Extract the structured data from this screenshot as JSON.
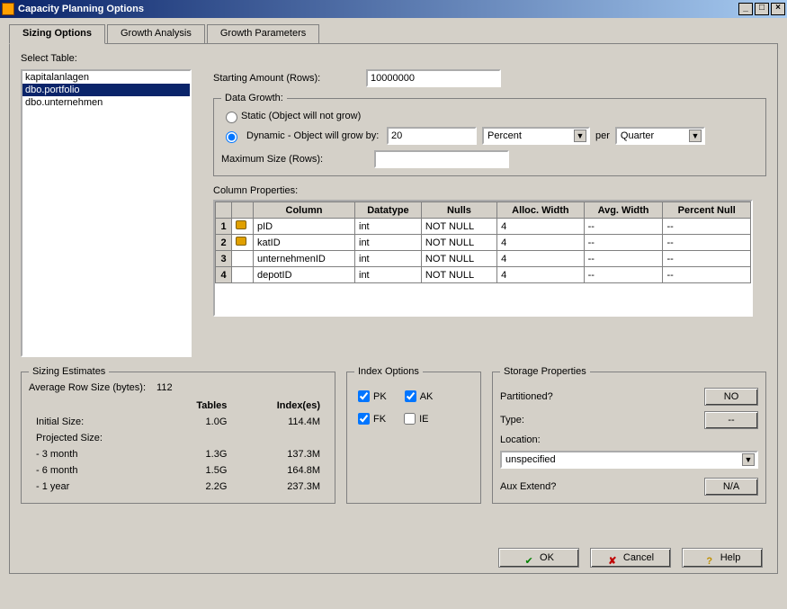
{
  "window": {
    "title": "Capacity Planning Options"
  },
  "tabs": [
    "Sizing Options",
    "Growth Analysis",
    "Growth Parameters"
  ],
  "active_tab": 0,
  "labels": {
    "select_table": "Select Table:",
    "starting_amount": "Starting Amount (Rows):",
    "data_growth": "Data Growth:",
    "static": "Static (Object will not grow)",
    "dynamic": "Dynamic - Object will grow by:",
    "per": "per",
    "max_size": "Maximum Size (Rows):",
    "column_props": "Column Properties:",
    "sizing_estimates": "Sizing Estimates",
    "avg_row_size": "Average Row Size (bytes):",
    "tables": "Tables",
    "indexes": "Index(es)",
    "initial_size": "Initial Size:",
    "projected_size": "Projected Size:",
    "m3": "- 3 month",
    "m6": "- 6 month",
    "y1": "- 1 year",
    "index_options": "Index Options",
    "pk": "PK",
    "ak": "AK",
    "fk": "FK",
    "ie": "IE",
    "storage_props": "Storage Properties",
    "partitioned": "Partitioned?",
    "type": "Type:",
    "location": "Location:",
    "aux_extend": "Aux Extend?"
  },
  "tables_list": [
    "kapitalanlagen",
    "dbo.portfolio",
    "dbo.unternehmen"
  ],
  "tables_selected_index": 1,
  "starting_rows": "10000000",
  "growth": {
    "mode": "dynamic",
    "amount": "20",
    "unit": "Percent",
    "period": "Quarter",
    "max_rows": ""
  },
  "columns_header": [
    "Column",
    "Datatype",
    "Nulls",
    "Alloc. Width",
    "Avg. Width",
    "Percent Null"
  ],
  "columns": [
    {
      "icon": true,
      "name": "pID",
      "datatype": "int",
      "nulls": "NOT NULL",
      "alloc": "4",
      "avg": "--",
      "pct": "--"
    },
    {
      "icon": true,
      "name": "katID",
      "datatype": "int",
      "nulls": "NOT NULL",
      "alloc": "4",
      "avg": "--",
      "pct": "--"
    },
    {
      "icon": false,
      "name": "unternehmenID",
      "datatype": "int",
      "nulls": "NOT NULL",
      "alloc": "4",
      "avg": "--",
      "pct": "--"
    },
    {
      "icon": false,
      "name": "depotID",
      "datatype": "int",
      "nulls": "NOT NULL",
      "alloc": "4",
      "avg": "--",
      "pct": "--"
    }
  ],
  "sizing": {
    "avg_row_bytes": "112",
    "rows": [
      {
        "label": "Initial Size:",
        "tables": "1.0G",
        "indexes": "114.4M"
      },
      {
        "label": "Projected Size:",
        "tables": "",
        "indexes": ""
      },
      {
        "label": "- 3 month",
        "tables": "1.3G",
        "indexes": "137.3M"
      },
      {
        "label": "- 6 month",
        "tables": "1.5G",
        "indexes": "164.8M"
      },
      {
        "label": "- 1 year",
        "tables": "2.2G",
        "indexes": "237.3M"
      }
    ]
  },
  "index_options": {
    "pk": true,
    "ak": true,
    "fk": true,
    "ie": false
  },
  "storage": {
    "partitioned": "NO",
    "type": "--",
    "location": "unspecified",
    "aux_extend": "N/A"
  },
  "buttons": {
    "ok": "OK",
    "cancel": "Cancel",
    "help": "Help"
  }
}
